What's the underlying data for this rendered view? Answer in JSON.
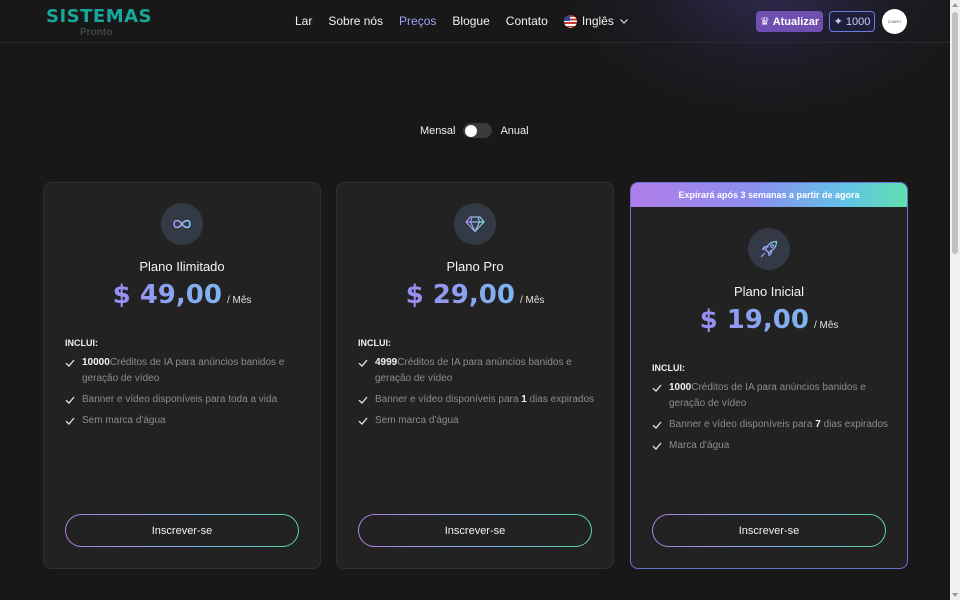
{
  "header": {
    "logo_main": "SISTEMAS",
    "logo_sub": "Pronto",
    "nav": [
      "Lar",
      "Sobre nós",
      "Preços",
      "Blogue",
      "Contato"
    ],
    "active_nav": "Preços",
    "language": "Inglês",
    "upgrade_label": "Atualizar",
    "credits": "1000",
    "avatar_text": "ZVARO"
  },
  "billing": {
    "monthly_label": "Mensal",
    "annual_label": "Anual",
    "annual_selected": false
  },
  "plans": [
    {
      "name": "Plano Ilimitado",
      "price": "$ 49,00",
      "period": "/ Mês",
      "includes_label": "INCLUI:",
      "icon": "infinity-icon",
      "features": [
        {
          "bold": "10000",
          "text": "Créditos de IA para anúncios banidos e geração de vídeo"
        },
        {
          "bold": "",
          "text": "Banner e vídeo disponíveis para toda a vida"
        },
        {
          "bold": "",
          "text": "Sem marca d'água"
        }
      ],
      "cta": "Inscrever-se"
    },
    {
      "name": "Plano Pro",
      "price": "$ 29,00",
      "period": "/ Mês",
      "includes_label": "INCLUI:",
      "icon": "diamond-icon",
      "features": [
        {
          "bold": "4999",
          "text": "Créditos de IA para anúncios banidos e geração de vídeo"
        },
        {
          "bold": "",
          "text": "Banner e vídeo disponíveis para",
          "bold_mid": "1",
          "text_after": "dias expirados"
        },
        {
          "bold": "",
          "text": "Sem marca d'água"
        }
      ],
      "cta": "Inscrever-se"
    },
    {
      "name": "Plano Inicial",
      "price": "$ 19,00",
      "period": "/ Mês",
      "includes_label": "INCLUI:",
      "icon": "rocket-icon",
      "banner": "Expirará após 3 semanas a partir de agora",
      "features": [
        {
          "bold": "1000",
          "text": "Créditos de IA para anúncios banidos e geração de vídeo"
        },
        {
          "bold": "",
          "text": "Banner e vídeo disponíveis para",
          "bold_mid": "7",
          "text_after": "dias expirados"
        },
        {
          "bold": "",
          "text": "Marca d'água"
        }
      ],
      "cta": "Inscrever-se"
    }
  ],
  "colors": {
    "logo": "#17a89b",
    "active_nav": "#9aa4f7",
    "upgrade_bg": "#6f4fb0",
    "featured_border": "#6673d6",
    "price_gradient_start": "#9a8cf2",
    "price_gradient_end": "#7eb6f0"
  }
}
